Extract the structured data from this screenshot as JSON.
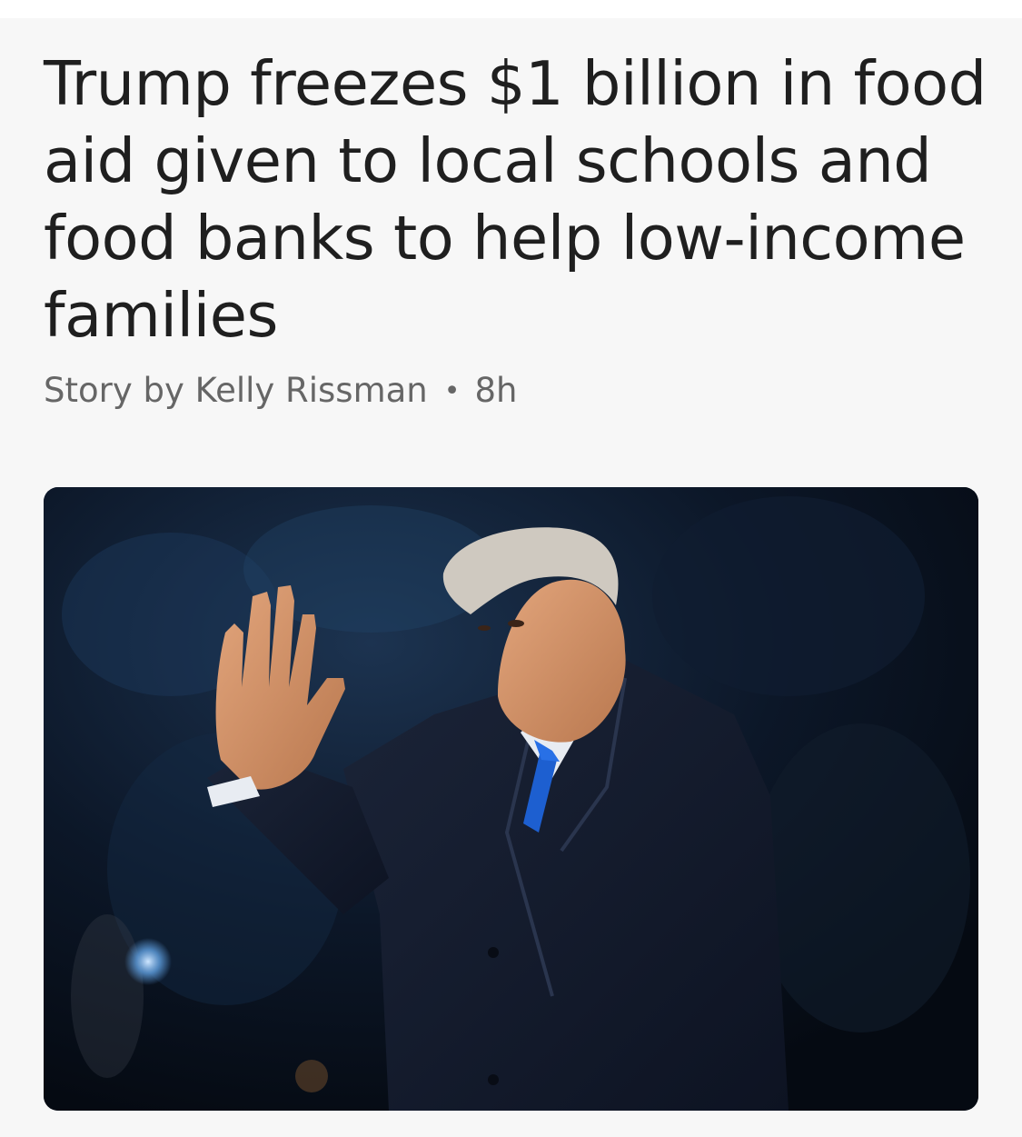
{
  "article": {
    "headline_lines": [
      "Trump freezes $1 billion in food",
      "aid given to local schools and",
      "food banks to help low-income",
      "families"
    ],
    "byline": {
      "prefix": "Story by Kelly Rissman",
      "separator": "•",
      "age": "8h"
    }
  },
  "colors": {
    "headline": "#1f1f1f",
    "byline": "#666666",
    "card_background": "#f7f7f7",
    "photo_background": "#0a1220"
  }
}
